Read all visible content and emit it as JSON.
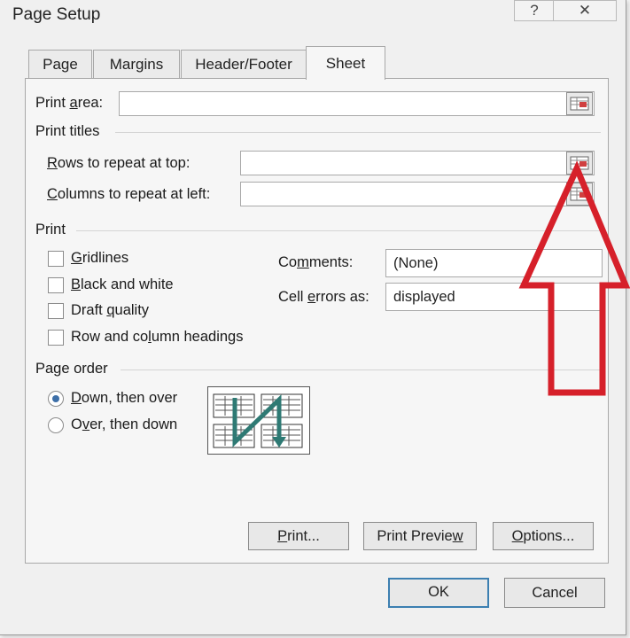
{
  "window": {
    "title": "Page Setup",
    "help_label": "?",
    "close_label": "✕"
  },
  "tabs": [
    {
      "label": "Page"
    },
    {
      "label": "Margins"
    },
    {
      "label": "Header/Footer"
    },
    {
      "label": "Sheet",
      "active": true
    }
  ],
  "print_area": {
    "prefix": "Print ",
    "access": "a",
    "suffix": "rea:",
    "value": ""
  },
  "print_titles": {
    "heading": "Print titles",
    "rows": {
      "access": "R",
      "suffix": "ows to repeat at top:",
      "value": ""
    },
    "columns": {
      "access": "C",
      "suffix": "olumns to repeat at left:",
      "value": ""
    }
  },
  "print_section": {
    "heading": "Print",
    "checkboxes": [
      {
        "access": "G",
        "rest": "ridlines",
        "checked": false
      },
      {
        "access": "B",
        "rest": "lack and white",
        "checked": false
      },
      {
        "pre": "Draft ",
        "access": "q",
        "rest": "uality",
        "checked": false
      },
      {
        "pre": "Row and co",
        "access": "l",
        "rest": "umn headings",
        "checked": false
      }
    ],
    "comments": {
      "pre": "Co",
      "access": "m",
      "rest": "ments:",
      "value": "(None)"
    },
    "cell_errors": {
      "pre": "Cell ",
      "access": "e",
      "rest": "rrors as:",
      "value": "displayed"
    }
  },
  "page_order": {
    "heading": "Page order",
    "options": [
      {
        "access": "D",
        "rest": "own, then over",
        "selected": true
      },
      {
        "pre": "O",
        "access": "v",
        "rest": "er, then down",
        "selected": false
      }
    ]
  },
  "buttons": {
    "print": {
      "access": "P",
      "rest": "rint..."
    },
    "preview": {
      "pre": "Print Previe",
      "access": "w",
      "rest": ""
    },
    "options": {
      "access": "O",
      "rest": "ptions..."
    },
    "ok": "OK",
    "cancel": "Cancel"
  },
  "colors": {
    "annotation_arrow": "#d6202a",
    "order_arrow": "#2e7a74",
    "radio_dot": "#3d6fa8",
    "default_button_border": "#3c7fb1"
  },
  "icons": [
    "collapse-dialog-icon",
    "page-order-diagram",
    "annotation-arrow"
  ]
}
